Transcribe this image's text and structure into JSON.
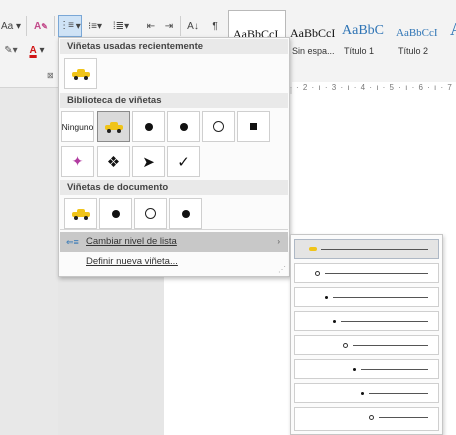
{
  "ribbon": {
    "font_size_fragment": "Aa",
    "font_color_letter": "A",
    "clear_format_icon": "eraser-a-icon",
    "sort_label": "A↓",
    "pilcrow": "¶",
    "launcher": "⊠"
  },
  "styles": [
    {
      "sample": "AaBbCcI",
      "name": ""
    },
    {
      "sample": "AaBbCcI",
      "name": "Sin espa..."
    },
    {
      "sample": "AaBbC",
      "name": "Título 1"
    },
    {
      "sample": "AaBbCcI",
      "name": "Título 2"
    },
    {
      "sample": "A",
      "name": ""
    }
  ],
  "ruler_text": "· 2 · ı · 3 · ı · 4 · ı · 5 · ı · 6 · ı · 7 ·",
  "dropdown": {
    "recent_header": "Viñetas usadas recientemente",
    "library_header": "Biblioteca de viñetas",
    "document_header": "Viñetas de documento",
    "none_label": "Ninguno",
    "change_level_label": "Cambiar nivel de lista",
    "define_label": "Definir nueva viñeta...",
    "submenu_arrow": "›"
  },
  "library_glyphs": {
    "diamond_cluster": "❖",
    "arrowhead": "➤",
    "checkmark": "✓"
  },
  "accent_colors": {
    "car_yellow": "#f0c419",
    "selection_blue": "#cfe3f6",
    "heading_blue": "#2e74b5"
  }
}
